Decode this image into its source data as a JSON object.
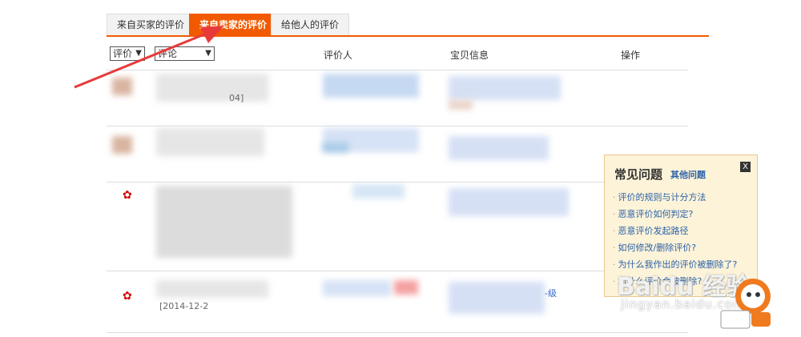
{
  "tabs": [
    {
      "label": "来自买家的评价",
      "active": false
    },
    {
      "label": "来自卖家的评价",
      "active": true
    },
    {
      "label": "给他人的评价",
      "active": false
    }
  ],
  "filters": {
    "rating_select": "评价",
    "comment_select": "评论"
  },
  "columns": {
    "reviewer": "评价人",
    "item_info": "宝贝信息",
    "actions": "操作"
  },
  "rows": [
    {
      "date_fragment": "04]",
      "level_fragment": ""
    },
    {
      "date_fragment": "",
      "level_fragment": ""
    },
    {
      "date_fragment": "",
      "level_fragment": ""
    },
    {
      "date_fragment": "[2014-12-2",
      "level_fragment": "-级"
    }
  ],
  "faq": {
    "title": "常见问题",
    "other_link": "其他问题",
    "close": "X",
    "items": [
      "评价的规则与计分方法",
      "恶意评价如何判定?",
      "恶意评价发起路径",
      "如何修改/删除评价?",
      "为什么我作出的评价被删除了?",
      "为什么评价会被删除?"
    ]
  },
  "watermark": {
    "text": "Baidu 经验",
    "url": "jingyan.baidu.com"
  },
  "colors": {
    "accent": "#f15a00",
    "link": "#2a62a8",
    "faq_bg": "#fdf3d9",
    "annotation_arrow": "#e83a3a"
  }
}
